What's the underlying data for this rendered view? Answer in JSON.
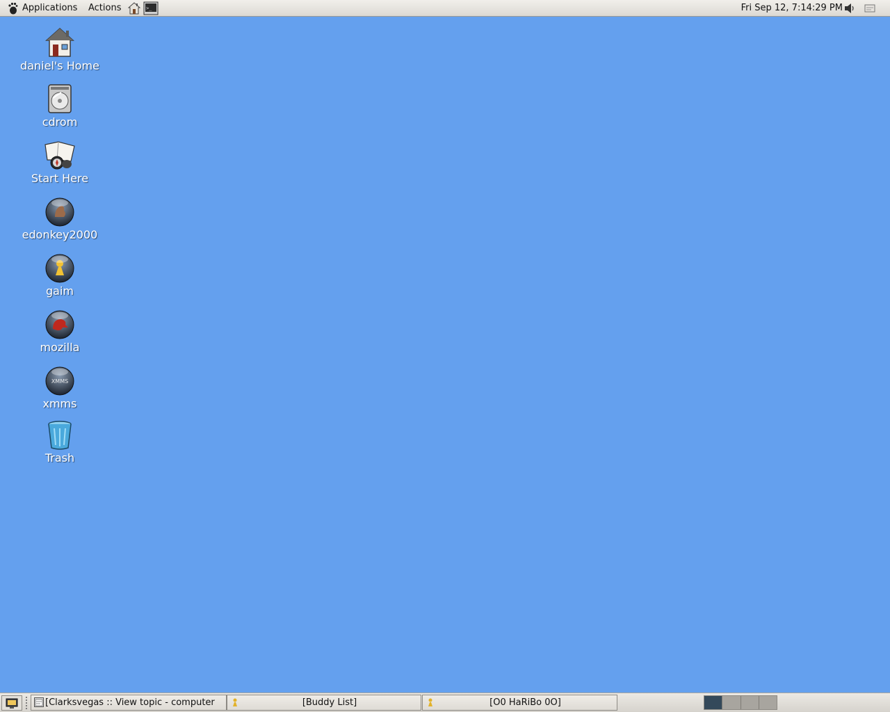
{
  "top_panel": {
    "menus": {
      "applications": "Applications",
      "actions": "Actions"
    },
    "launchers": [
      "home-icon",
      "terminal-icon"
    ],
    "clock": "Fri Sep 12,  7:14:29 PM",
    "tray": [
      "volume-icon",
      "notification-icon"
    ]
  },
  "desktop": {
    "background_color": "#64a0ee",
    "icons": [
      {
        "label": "daniel's Home",
        "icon": "home-folder-icon"
      },
      {
        "label": "cdrom",
        "icon": "cdrom-drive-icon"
      },
      {
        "label": "Start Here",
        "icon": "start-here-icon"
      },
      {
        "label": "edonkey2000",
        "icon": "edonkey-icon"
      },
      {
        "label": "gaim",
        "icon": "gaim-icon"
      },
      {
        "label": "mozilla",
        "icon": "mozilla-icon"
      },
      {
        "label": "xmms",
        "icon": "xmms-icon"
      },
      {
        "label": "Trash",
        "icon": "trash-icon"
      }
    ]
  },
  "bottom_panel": {
    "tasks": [
      {
        "label": "[Clarksvegas :: View topic - computer",
        "icon": "browser-window-icon"
      },
      {
        "label": "[Buddy List]",
        "icon": "gaim-small-icon"
      },
      {
        "label": "[O0 HaRiBo 0O]",
        "icon": "gaim-small-icon"
      }
    ],
    "workspaces": {
      "count": 4,
      "active_index": 0
    }
  }
}
